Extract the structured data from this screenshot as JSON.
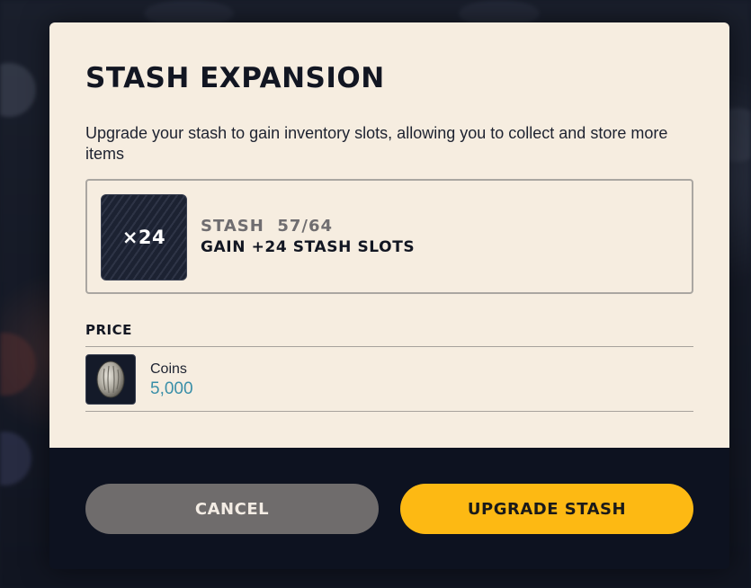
{
  "dialog": {
    "title": "STASH EXPANSION",
    "description": "Upgrade your stash to gain inventory slots, allowing you to collect and store more items",
    "item": {
      "quantity": "×24",
      "stash_count": "STASH  57/64",
      "gain_text": "GAIN +24 STASH SLOTS"
    },
    "price": {
      "label": "PRICE",
      "currency_name": "Coins",
      "amount": "5,000",
      "icon": "coin-icon"
    },
    "buttons": {
      "cancel": "CANCEL",
      "upgrade": "UPGRADE STASH"
    }
  },
  "colors": {
    "accent": "#fdb913",
    "panel": "#f6ede0",
    "footer": "#0d1220",
    "price_text": "#3a8fa8"
  }
}
